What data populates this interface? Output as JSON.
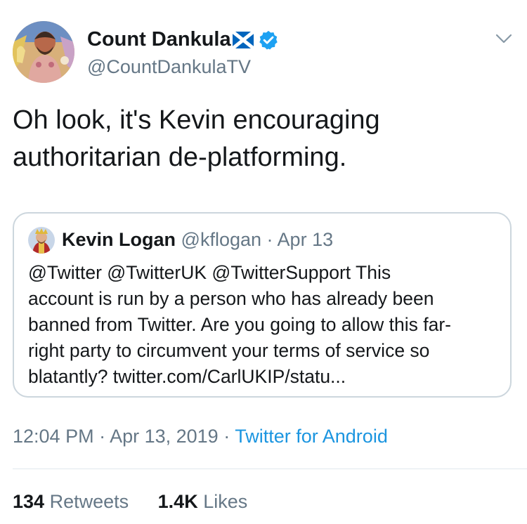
{
  "tweet": {
    "author": {
      "display_name": "Count Dankula",
      "flag": "scotland-flag-icon",
      "verified": true,
      "handle": "@CountDankulaTV"
    },
    "text_lines": [
      "Oh look, it's Kevin encouraging",
      "authoritarian de-platforming."
    ],
    "quoted": {
      "display_name": "Kevin Logan",
      "handle": "@kflogan",
      "separator": "·",
      "date": "Apr 13",
      "text_lines": [
        "@Twitter @TwitterUK @TwitterSupport This",
        "account is run by a person who has already been",
        "banned from Twitter. Are you going to allow this far-",
        "right party to circumvent your terms of service so",
        "blatantly? twitter.com/CarlUKIP/statu..."
      ]
    },
    "timestamp": "12:04 PM · Apr 13, 2019",
    "separator": "·",
    "source": "Twitter for Android",
    "stats": {
      "retweets_count": "134",
      "retweets_label": "Retweets",
      "likes_count": "1.4K",
      "likes_label": "Likes"
    }
  },
  "colors": {
    "text": "#14171a",
    "secondary": "#657786",
    "link": "#1b95e0",
    "border": "#ccd6dd",
    "verified": "#1da1f2",
    "scotland_flag": "#0065bd"
  }
}
